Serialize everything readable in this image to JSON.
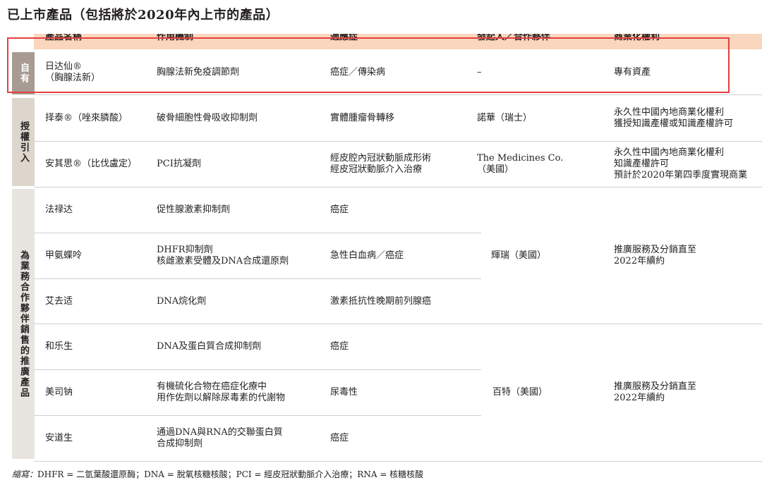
{
  "title": "已上市產品（包括將於2020年內上市的產品）",
  "headers": {
    "product": "產品名稱",
    "mechanism": "作用機制",
    "indication": "適應症",
    "partner": "發起人／合作夥伴",
    "rights": "商業化權利"
  },
  "groups": {
    "owned": "自有",
    "licensed": "授權引入",
    "promotion": "為業務合作夥伴銷售的推廣產品"
  },
  "rows": [
    {
      "product": [
        "日达仙®",
        "（胸腺法新）"
      ],
      "mechanism": [
        "胸腺法新免疫調節劑"
      ],
      "indication": [
        "癌症／傳染病"
      ],
      "partner": [
        "–"
      ],
      "rights": [
        "專有資產"
      ]
    },
    {
      "product": [
        "择泰®（唑來膦酸）"
      ],
      "mechanism": [
        "破骨細胞性骨吸收抑制劑"
      ],
      "indication": [
        "實體腫瘤骨轉移"
      ],
      "partner": [
        "諾華（瑞士）"
      ],
      "rights": [
        "永久性中國內地商業化權利",
        "獲授知識產權或知識產權許可"
      ]
    },
    {
      "product": [
        "安其思®（比伐盧定）"
      ],
      "mechanism": [
        "PCI抗凝劑"
      ],
      "indication": [
        "經皮腔內冠狀動脈成形術",
        "經皮冠狀動脈介入治療"
      ],
      "partner": [
        "The Medicines Co.",
        "（美國）"
      ],
      "rights": [
        "永久性中國內地商業化權利",
        "知識產權許可",
        "預計於2020年第四季度實現商業"
      ]
    },
    {
      "product": [
        "法禄达"
      ],
      "mechanism": [
        "促性腺激素抑制劑"
      ],
      "indication": [
        "癌症"
      ]
    },
    {
      "product": [
        "甲氨蝶呤"
      ],
      "mechanism": [
        "DHFR抑制劑",
        "核雌激素受體及DNA合成還原劑"
      ],
      "indication": [
        "急性白血病／癌症"
      ]
    },
    {
      "product": [
        "艾去适"
      ],
      "mechanism": [
        "DNA烷化劑"
      ],
      "indication": [
        "激素抵抗性晚期前列腺癌"
      ]
    },
    {
      "product": [
        "和乐生"
      ],
      "mechanism": [
        "DNA及蛋白質合成抑制劑"
      ],
      "indication": [
        "癌症"
      ]
    },
    {
      "product": [
        "美司钠"
      ],
      "mechanism": [
        "有機硫化合物在癌症化療中",
        "用作佐劑以解除尿毒素的代謝物"
      ],
      "indication": [
        "尿毒性"
      ]
    },
    {
      "product": [
        "安道生"
      ],
      "mechanism": [
        "通過DNA與RNA的交聯蛋白質",
        "合成抑制劑"
      ],
      "indication": [
        "癌症"
      ]
    }
  ],
  "merged": {
    "partner_pfizer": "輝瑞（美國）",
    "rights_pfizer": [
      "推廣服務及分銷直至",
      "2022年續約"
    ],
    "partner_baxter": "百特（美國）",
    "rights_baxter": [
      "推廣服務及分銷直至",
      "2022年續約"
    ]
  },
  "footnote": {
    "label": "縮寫：",
    "text": "DHFR = 二氫葉酸還原酶；DNA = 脫氧核糖核酸；PCI = 經皮冠狀動脈介入治療；RNA = 核糖核酸"
  },
  "colors": {
    "header_bg": "#f9d6bd",
    "owned_bg": "#a79b93",
    "licensed_bg": "#ddd6cc",
    "promotion_bg": "#e8e4e0",
    "highlight_border": "#e3403f"
  }
}
